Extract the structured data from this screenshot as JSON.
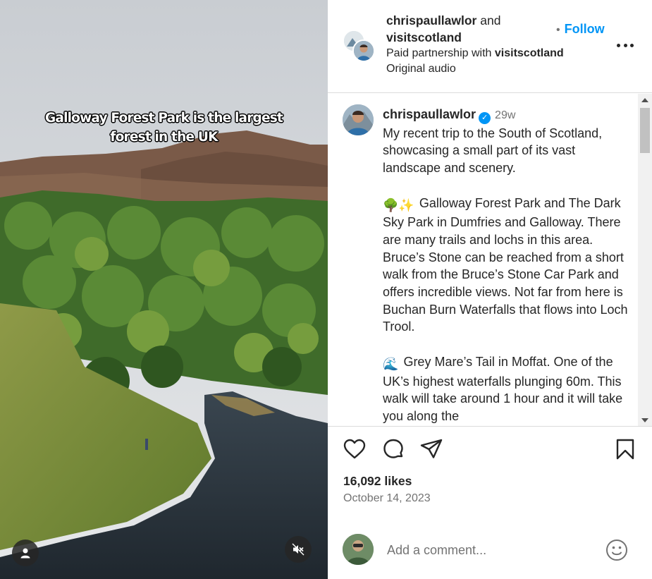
{
  "media": {
    "overlay_caption_line1": "Galloway Forest Park is the largest",
    "overlay_caption_line2": "forest in the UK",
    "tagged_icon": "user-icon",
    "mute_icon": "muted-speaker-icon"
  },
  "header": {
    "username": "chrispaullawlor",
    "and_text": "and",
    "collab_username": "visitscotland",
    "partnership_prefix": "Paid partnership with",
    "partnership_account": "visitscotland",
    "audio": "Original audio",
    "follow_separator": "•",
    "follow_label": "Follow"
  },
  "caption": {
    "username": "chrispaullawlor",
    "verified_mark": "✓",
    "time": "29w",
    "intro": "My recent trip to the South of Scotland, showcasing a small part of its vast landscape and scenery.",
    "para1_emojis": "🌳✨",
    "para1": "Galloway Forest Park and The Dark Sky Park in Dumfries and Galloway. There are many trails and lochs in this area. Bruce’s Stone can be reached from a short walk from the Bruce’s Stone Car Park and offers incredible views. Not far from here is Buchan Burn Waterfalls that flows into Loch Trool.",
    "para2_emoji": "🌊",
    "para2": "Grey Mare’s Tail in Moffat. One of the UK’s highest waterfalls plunging 60m. This walk will take around 1 hour and it will take you along the"
  },
  "actions": {
    "like_icon": "heart-icon",
    "comment_icon": "comment-bubble-icon",
    "share_icon": "paper-plane-icon",
    "save_icon": "bookmark-icon"
  },
  "stats": {
    "likes": "16,092 likes",
    "date": "October 14, 2023"
  },
  "comment_box": {
    "placeholder": "Add a comment...",
    "emoji_icon": "smiley-icon"
  },
  "colors": {
    "accent": "#0095f6",
    "text": "#262626",
    "secondary_text": "#737373",
    "divider": "#dbdbdb"
  }
}
